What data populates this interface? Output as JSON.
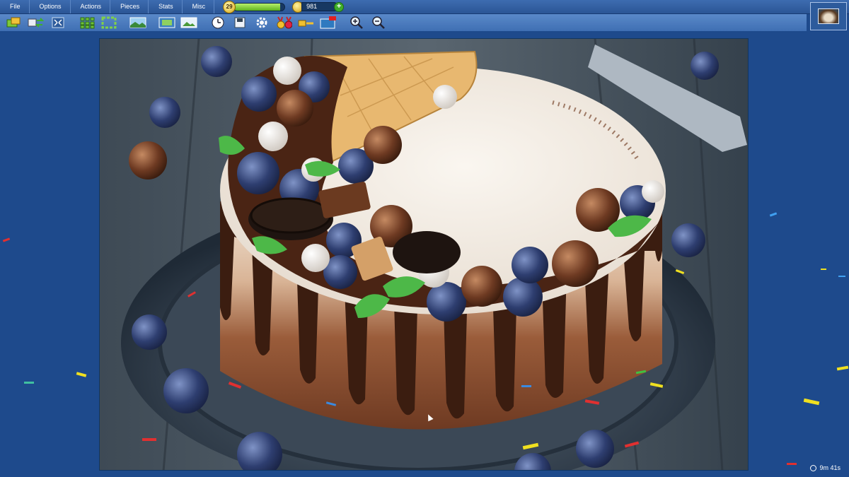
{
  "menu": {
    "items": [
      "File",
      "Options",
      "Actions",
      "Pieces",
      "Stats",
      "Misc"
    ]
  },
  "status": {
    "level": "29",
    "xp_progress_percent": 92,
    "coins": "981"
  },
  "toolbar": {
    "icons": [
      "shuffle-pieces-icon",
      "swap-pieces-icon",
      "fullscreen-icon",
      "pieces-grid-icon",
      "edge-pieces-icon",
      "background-landscape-icon",
      "photo-slideshow-icon",
      "picture-preview-icon",
      "timer-clock-icon",
      "save-disk-icon",
      "settings-gear-icon",
      "achievements-medal-icon",
      "gift-key-icon",
      "new-puzzles-icon",
      "zoom-in-icon",
      "zoom-out-icon"
    ]
  },
  "timer": {
    "elapsed": "9m 41s"
  },
  "colors": {
    "background": "#1e4a8c",
    "menubar": "#2b5595",
    "toolbar": "#4a7bbf",
    "xp_fill": "#7cc936",
    "coin": "#e0b020"
  }
}
